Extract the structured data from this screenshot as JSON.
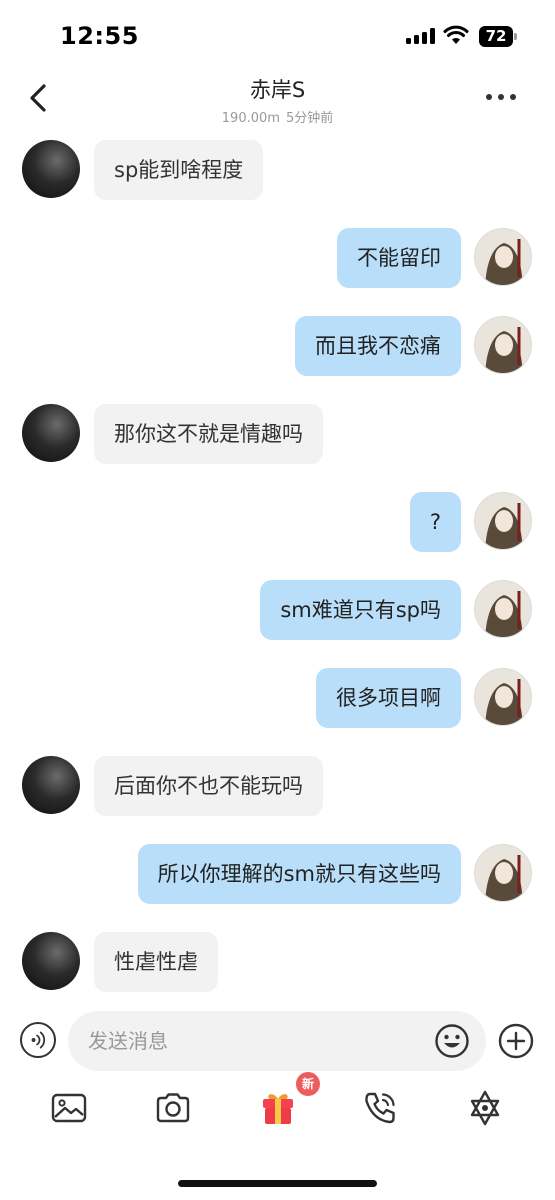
{
  "status_bar": {
    "time": "12:55",
    "battery": "72"
  },
  "header": {
    "title": "赤岸S",
    "distance": "190.00m",
    "last_seen": "5分钟前"
  },
  "messages": [
    {
      "side": "in",
      "text": "sp能到啥程度"
    },
    {
      "side": "out",
      "text": "不能留印"
    },
    {
      "side": "out",
      "text": "而且我不恋痛"
    },
    {
      "side": "in",
      "text": "那你这不就是情趣吗"
    },
    {
      "side": "out",
      "text": "?"
    },
    {
      "side": "out",
      "text": "sm难道只有sp吗"
    },
    {
      "side": "out",
      "text": "很多项目啊"
    },
    {
      "side": "in",
      "text": "后面你不也不能玩吗"
    },
    {
      "side": "out",
      "text": "所以你理解的sm就只有这些吗"
    },
    {
      "side": "in",
      "text": "性虐性虐"
    }
  ],
  "input": {
    "placeholder": "发送消息",
    "value": ""
  },
  "toolbar": {
    "items": [
      "image-icon",
      "camera-icon",
      "gift-icon",
      "call-icon",
      "star-of-david-icon"
    ],
    "gift_badge": "新"
  },
  "colors": {
    "outgoing_bubble": "#b9def9",
    "incoming_bubble": "#f2f2f2",
    "badge": "#ee5d5d"
  }
}
